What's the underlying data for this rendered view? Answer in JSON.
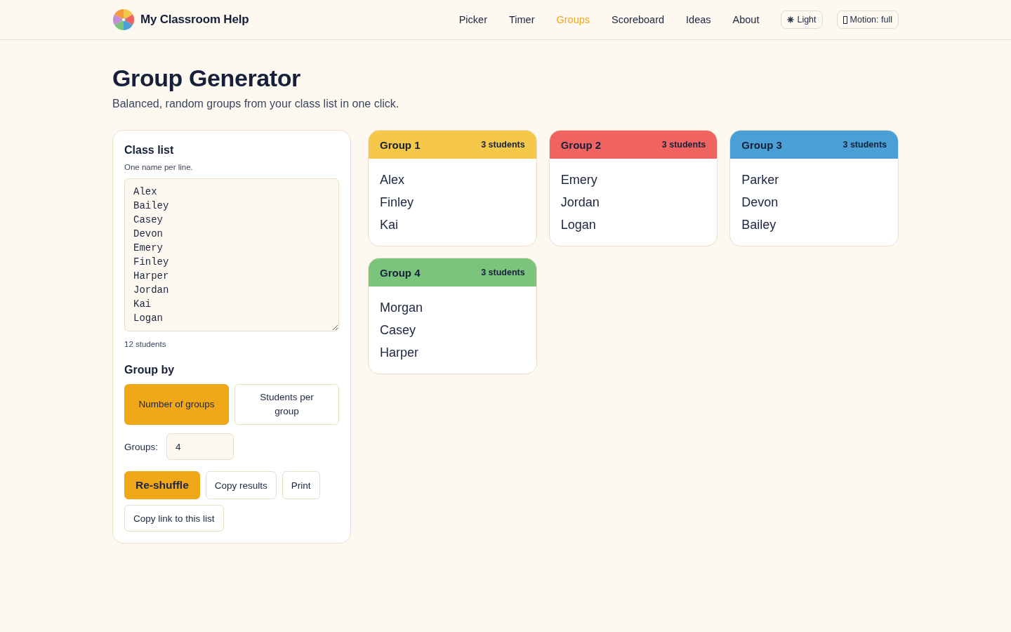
{
  "header": {
    "brand": "My Classroom Help",
    "nav": [
      {
        "label": "Picker",
        "selected": false
      },
      {
        "label": "Timer",
        "selected": false
      },
      {
        "label": "Groups",
        "selected": true
      },
      {
        "label": "Scoreboard",
        "selected": false
      },
      {
        "label": "Ideas",
        "selected": false
      },
      {
        "label": "About",
        "selected": false
      }
    ],
    "theme_button": "Light",
    "motion_button": "Motion: full"
  },
  "page": {
    "title": "Group Generator",
    "subtitle": "Balanced, random groups from your class list in one click."
  },
  "class_list": {
    "label": "Class list",
    "hint": "One name per line.",
    "names": [
      "Alex",
      "Bailey",
      "Casey",
      "Devon",
      "Emery",
      "Finley",
      "Harper",
      "Jordan",
      "Kai",
      "Logan"
    ],
    "count": "12 students"
  },
  "group_by": {
    "label": "Group by",
    "options": [
      {
        "label": "Number of groups",
        "selected": true
      },
      {
        "label": "Students per group",
        "selected": false
      }
    ],
    "field_label": "Groups:",
    "field_value": "4"
  },
  "actions": [
    {
      "label": "Re-shuffle",
      "kind": "primary"
    },
    {
      "label": "Copy results",
      "kind": "secondary"
    },
    {
      "label": "Print",
      "kind": "secondary"
    },
    {
      "label": "Copy link to this list",
      "kind": "secondary"
    }
  ],
  "groups": [
    {
      "title": "Group 1",
      "count": "3 students",
      "color": "#f5c84a",
      "members": [
        "Alex",
        "Finley",
        "Kai"
      ]
    },
    {
      "title": "Group 2",
      "count": "3 students",
      "color": "#ef6461",
      "members": [
        "Emery",
        "Jordan",
        "Logan"
      ]
    },
    {
      "title": "Group 3",
      "count": "3 students",
      "color": "#4a9fd4",
      "members": [
        "Parker",
        "Devon",
        "Bailey"
      ]
    },
    {
      "title": "Group 4",
      "count": "3 students",
      "color": "#7ac47c",
      "members": [
        "Morgan",
        "Casey",
        "Harper"
      ]
    }
  ]
}
